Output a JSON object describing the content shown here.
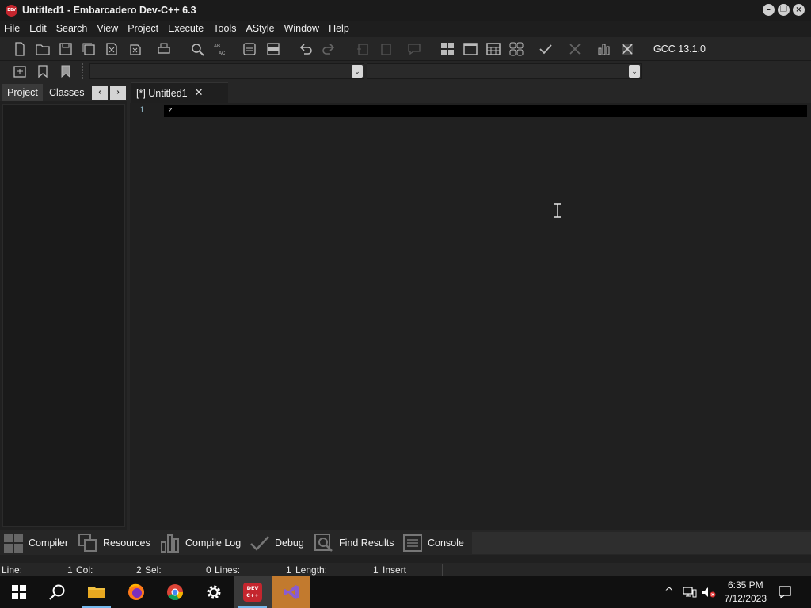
{
  "window": {
    "title": "Untitled1 - Embarcadero Dev-C++ 6.3",
    "logo_text": "DEV"
  },
  "menu": [
    "File",
    "Edit",
    "Search",
    "View",
    "Project",
    "Execute",
    "Tools",
    "AStyle",
    "Window",
    "Help"
  ],
  "toolbar": {
    "compiler": "GCC 13.1.0"
  },
  "left_panel": {
    "tabs": [
      "Project",
      "Classes"
    ],
    "active_tab": "Project"
  },
  "editor": {
    "tab_label": "[*] Untitled1",
    "line_numbers": [
      "1"
    ],
    "lines": [
      "z"
    ]
  },
  "bottom_tabs": [
    "Compiler",
    "Resources",
    "Compile Log",
    "Debug",
    "Find Results",
    "Console"
  ],
  "status": {
    "line_label": "Line:",
    "line_value": "1",
    "col_label": "Col:",
    "col_value": "2",
    "sel_label": "Sel:",
    "sel_value": "0",
    "lines_label": "Lines:",
    "lines_value": "1",
    "length_label": "Length:",
    "length_value": "1",
    "mode": "Insert"
  },
  "taskbar": {
    "time": "6:35 PM",
    "date": "7/12/2023",
    "dev_label": "DEV\nC++"
  },
  "colors": {
    "background": "#202020",
    "current_line": "#000000",
    "taskbar_highlight": "#c27a2e",
    "dev_logo": "#c4262e"
  }
}
